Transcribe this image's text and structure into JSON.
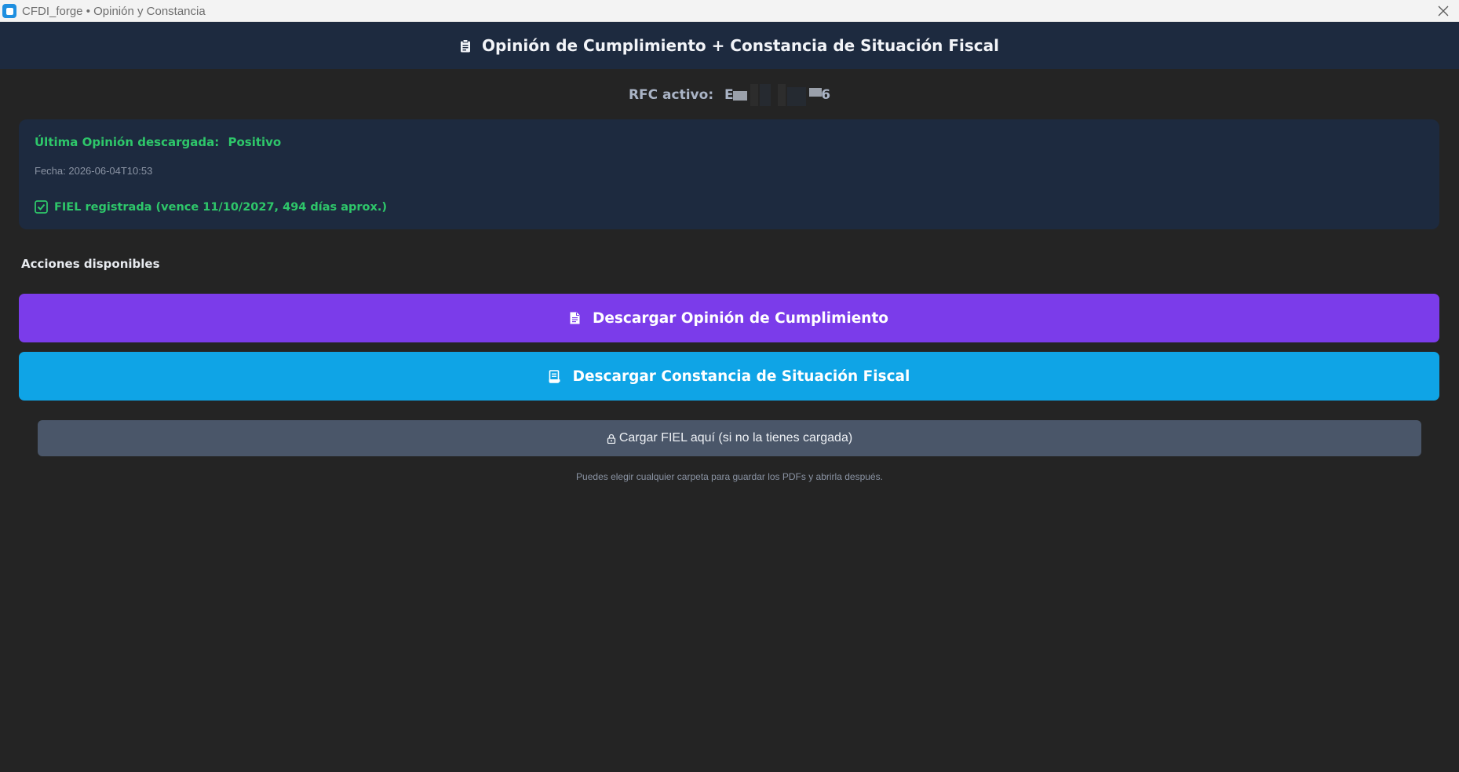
{
  "window": {
    "title": "CFDI_forge • Opinión y Constancia",
    "app_icon": "app-logo-icon",
    "close_icon": "close-icon"
  },
  "header": {
    "title": "Opinión de Cumplimiento + Constancia de Situación Fiscal",
    "icon": "clipboard-icon"
  },
  "rfc": {
    "label": "RFC activo:",
    "value_first_char": "E",
    "value_last_char": "6"
  },
  "status_card": {
    "last_opinion_label": "Última Opinión descargada:",
    "last_opinion_value": "Positivo",
    "date_text": "Fecha: 2026-06-04T10:53",
    "fiel_text": "FIEL registrada (vence 11/10/2027, 494 días aprox.)",
    "fiel_icon": "check-box-icon"
  },
  "actions": {
    "heading": "Acciones disponibles",
    "download_opinion_label": "Descargar Opinión de Cumplimiento",
    "download_opinion_icon": "document-icon",
    "download_constancia_label": "Descargar Constancia de Situación Fiscal",
    "download_constancia_icon": "receipt-icon",
    "load_fiel_label": "Cargar FIEL aquí (si no la tienes cargada)",
    "load_fiel_icon": "lock-icon"
  },
  "hint": "Puedes elegir cualquier carpeta para guardar los PDFs y abrirla después.",
  "colors": {
    "background": "#242424",
    "header": "#1d2a3f",
    "success": "#2ec76a",
    "primary_purple": "#7b3cea",
    "primary_blue": "#0fa4e6",
    "secondary": "#4a5669"
  }
}
